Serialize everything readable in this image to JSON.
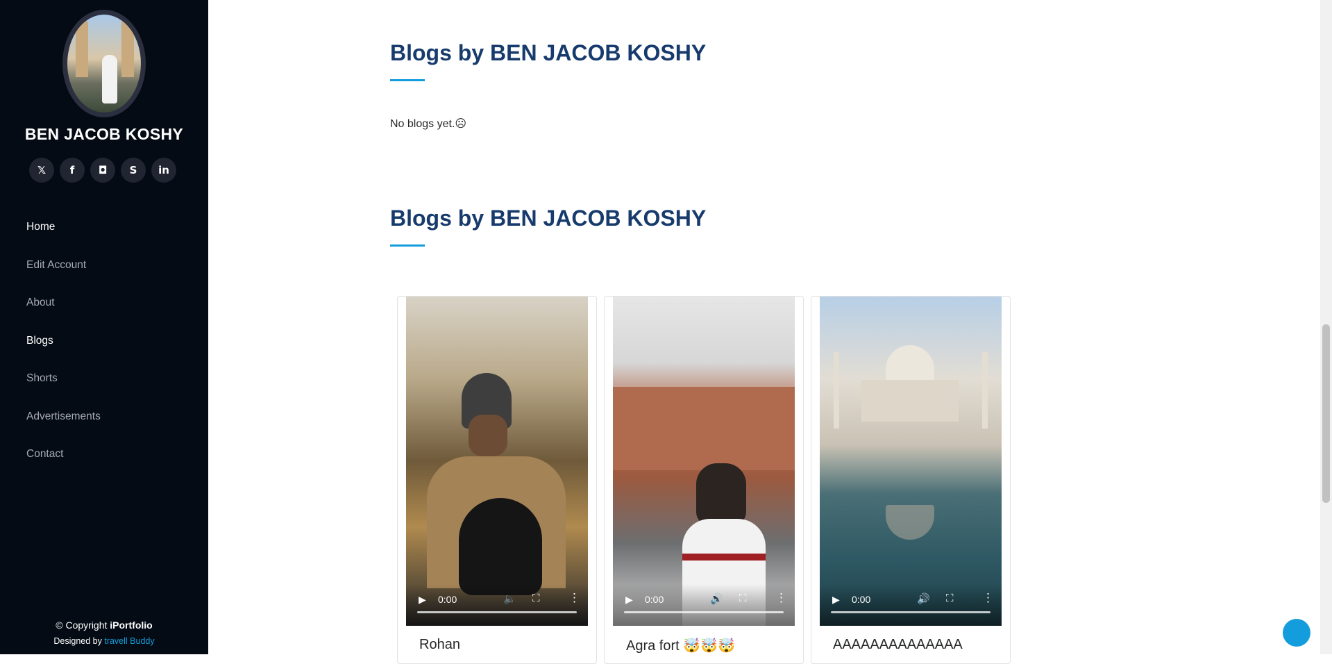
{
  "sidebar": {
    "profile_name": "BEN JACOB KOSHY",
    "social_icons": [
      "x-icon",
      "facebook-icon",
      "instagram-icon",
      "skype-icon",
      "linkedin-icon"
    ],
    "nav": [
      {
        "label": "Home",
        "active": true
      },
      {
        "label": "Edit Account",
        "active": false
      },
      {
        "label": "About",
        "active": false
      },
      {
        "label": "Blogs",
        "active": true
      },
      {
        "label": "Shorts",
        "active": false
      },
      {
        "label": "Advertisements",
        "active": false
      },
      {
        "label": "Contact",
        "active": false
      }
    ],
    "footer": {
      "copyright_prefix": "© Copyright ",
      "copyright_brand": "iPortfolio",
      "designed_prefix": "Designed by ",
      "designed_link": "travell Buddy"
    }
  },
  "main": {
    "section1": {
      "title": "Blogs by BEN JACOB KOSHY",
      "empty_text": "No blogs yet.☹"
    },
    "section2": {
      "title": "Blogs by BEN JACOB KOSHY",
      "cards": [
        {
          "title": "Rohan",
          "time": "0:00",
          "muted": true
        },
        {
          "title": "Agra fort 🤯🤯🤯",
          "time": "0:00",
          "muted": false
        },
        {
          "title": "AAAAAAAAAAAAAA",
          "time": "0:00",
          "muted": false
        }
      ]
    }
  },
  "colors": {
    "sidebar_bg": "#040b14",
    "accent": "#149ddd",
    "heading": "#173b6c"
  }
}
